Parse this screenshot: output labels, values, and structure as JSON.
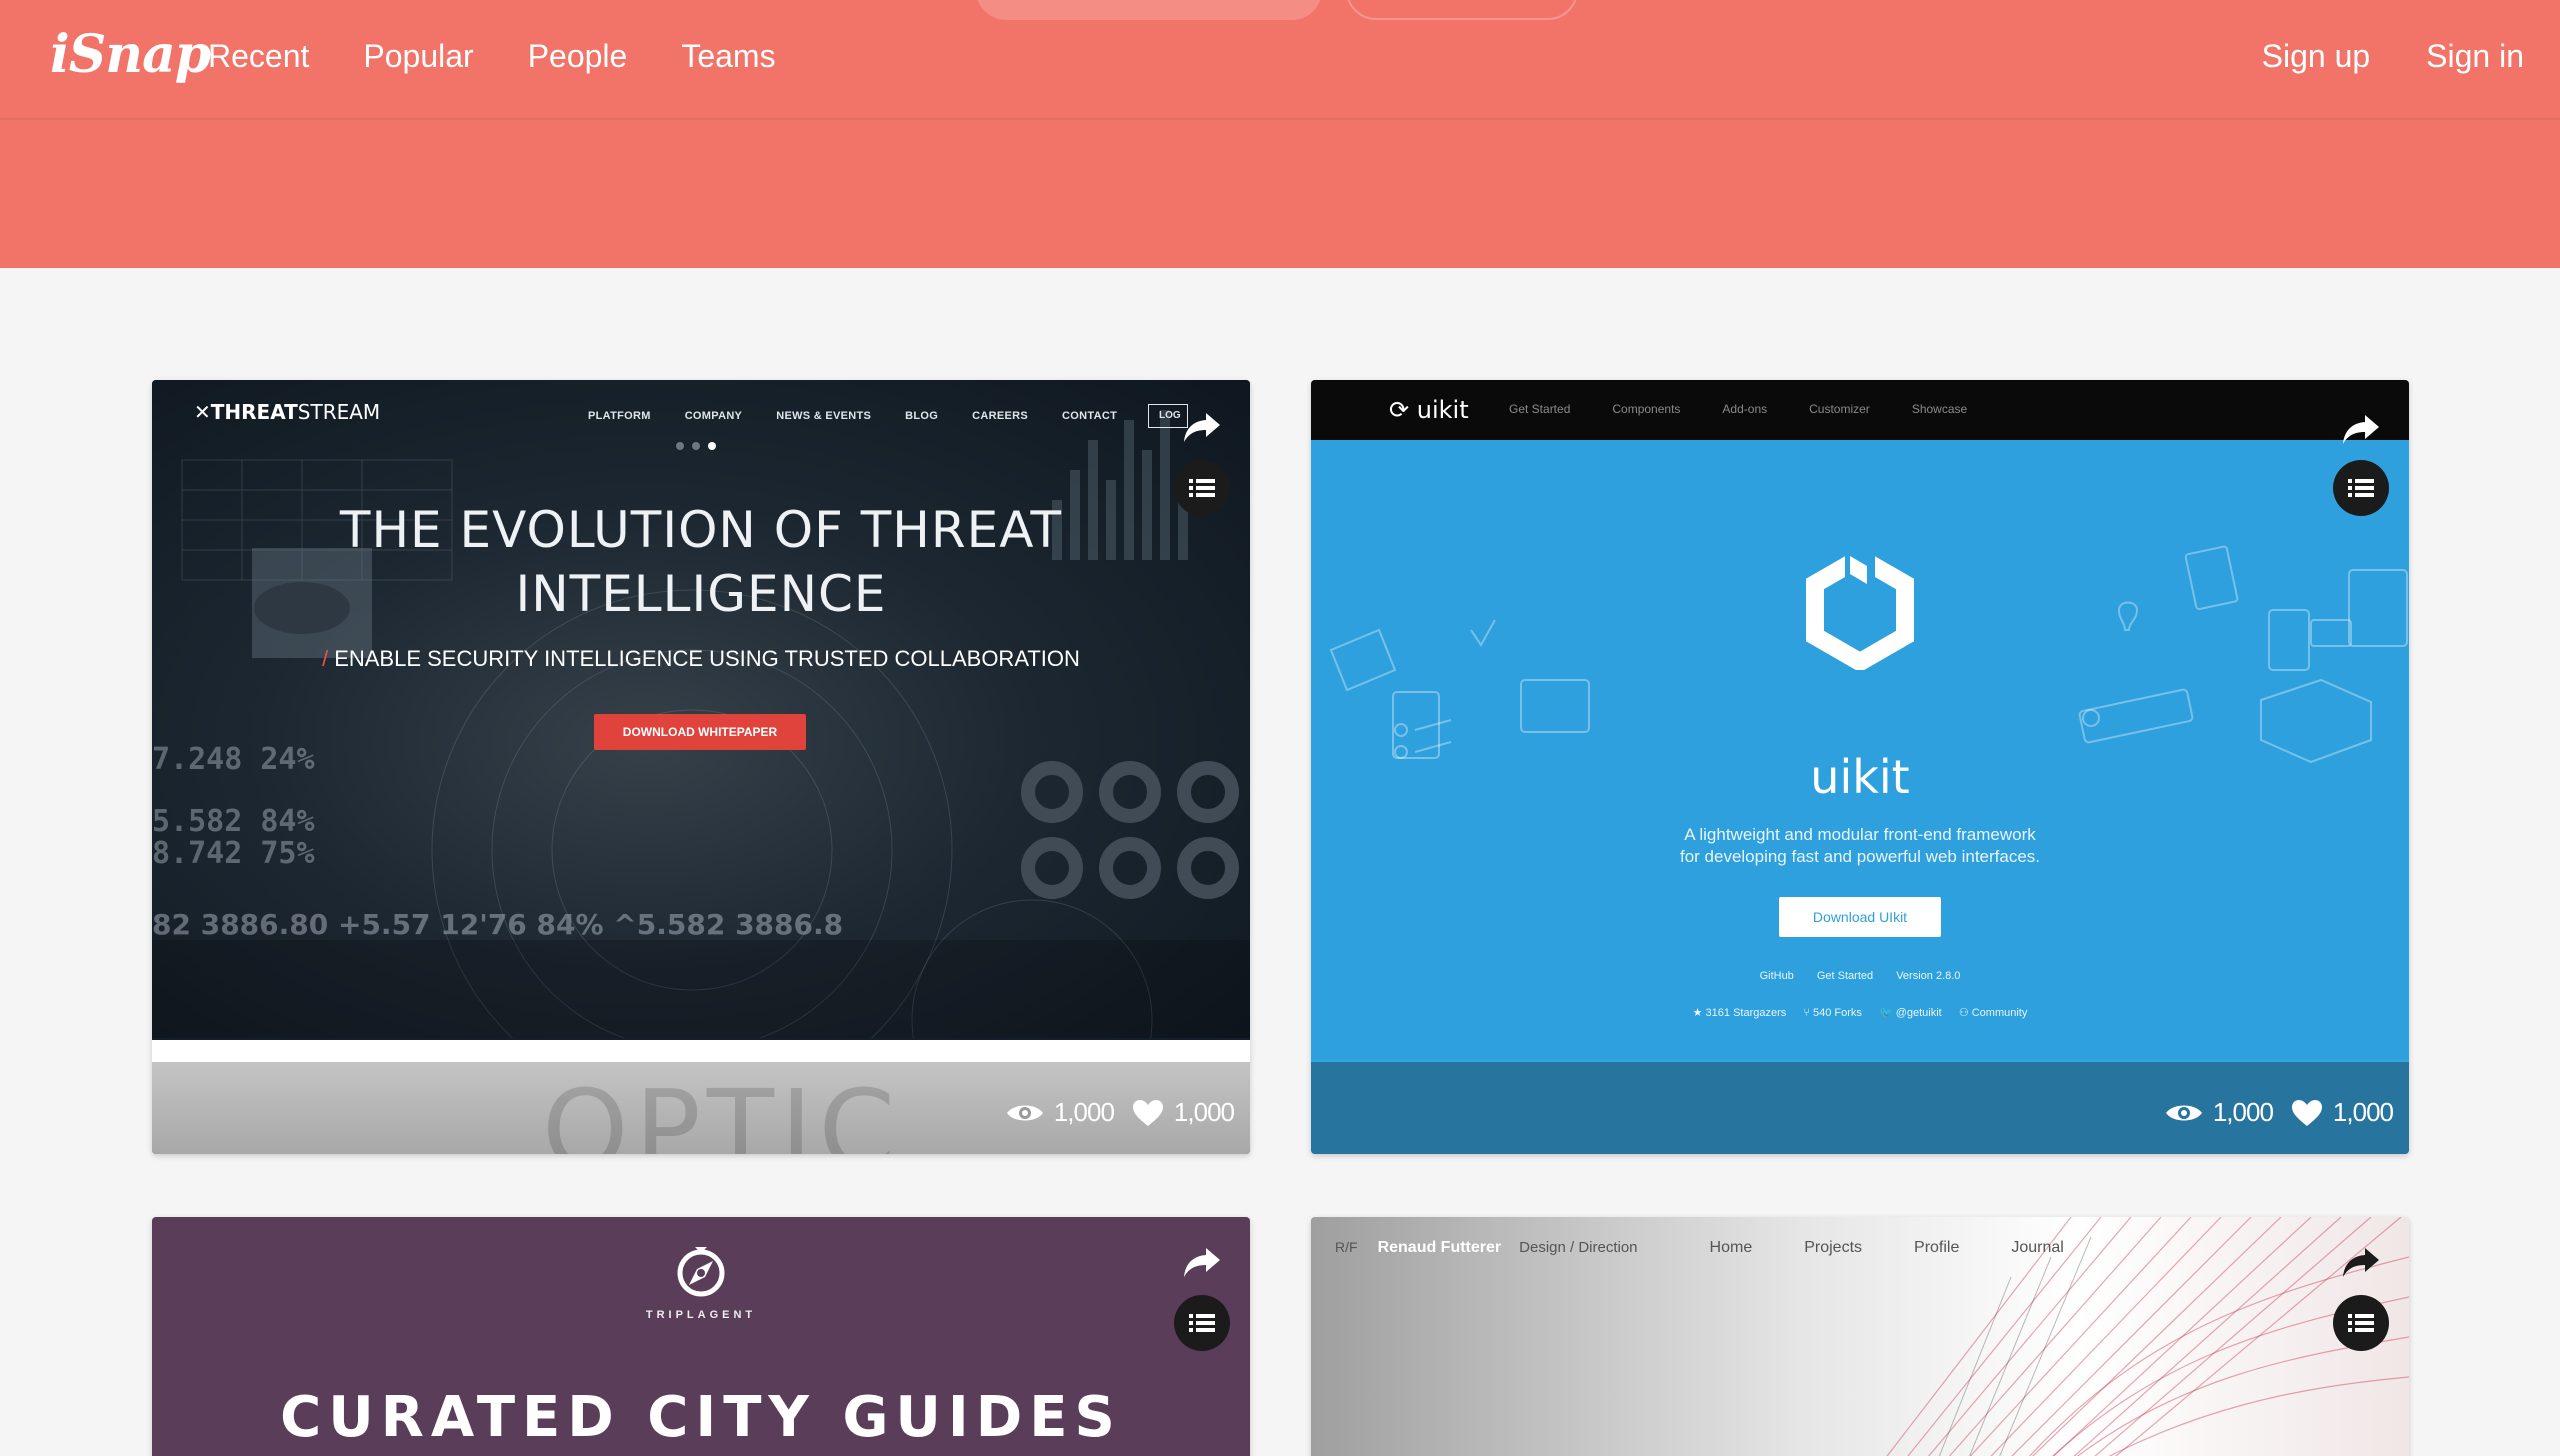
{
  "header": {
    "logo": "iSnap",
    "nav": [
      "Recent",
      "Popular",
      "People",
      "Teams"
    ],
    "auth": {
      "signup": "Sign up",
      "signin": "Sign in"
    },
    "accent_color": "#f27469"
  },
  "cards": [
    {
      "site": {
        "brand_bold": "THREAT",
        "brand_light": "STREAM",
        "menu": [
          "PLATFORM",
          "COMPANY",
          "NEWS & EVENTS",
          "BLOG",
          "CAREERS",
          "CONTACT"
        ],
        "login": "LOG",
        "title_line1": "THE EVOLUTION OF THREAT",
        "title_line2": "INTELLIGENCE",
        "subtitle_slash": "/",
        "subtitle": "ENABLE SECURITY INTELLIGENCE USING TRUSTED COLLABORATION",
        "cta": "DOWNLOAD WHITEPAPER",
        "num1": "7.248 24%",
        "num2": "5.582 84%",
        "num3": "8.742 75%",
        "stream": "82 3886.80 +5.57 12'76 84% ^5.582 3886.8",
        "footer_word": "OPTIC"
      },
      "views": "1,000",
      "likes": "1,000"
    },
    {
      "site": {
        "brand": "uikit",
        "menu": [
          "Get Started",
          "Components",
          "Add-ons",
          "Customizer",
          "Showcase"
        ],
        "title": "uikit",
        "desc_line1": "A lightweight and modular front-end framework",
        "desc_line2": "for developing fast and powerful web interfaces.",
        "cta": "Download UIkit",
        "links": [
          "GitHub",
          "Get Started",
          "Version 2.8.0"
        ],
        "meta": [
          "★ 3161 Stargazers",
          "⑂ 540 Forks",
          "🐦 @getuikit",
          "⚇ Community"
        ]
      },
      "views": "1,000",
      "likes": "1,000"
    },
    {
      "site": {
        "brand": "TRIPLAGENT",
        "title": "CURATED CITY GUIDES"
      }
    },
    {
      "site": {
        "rf": "R/F",
        "name": "Renaud Futterer",
        "role": "Design / Direction",
        "links": [
          "Home",
          "Projects",
          "Profile",
          "Journal"
        ]
      }
    }
  ]
}
